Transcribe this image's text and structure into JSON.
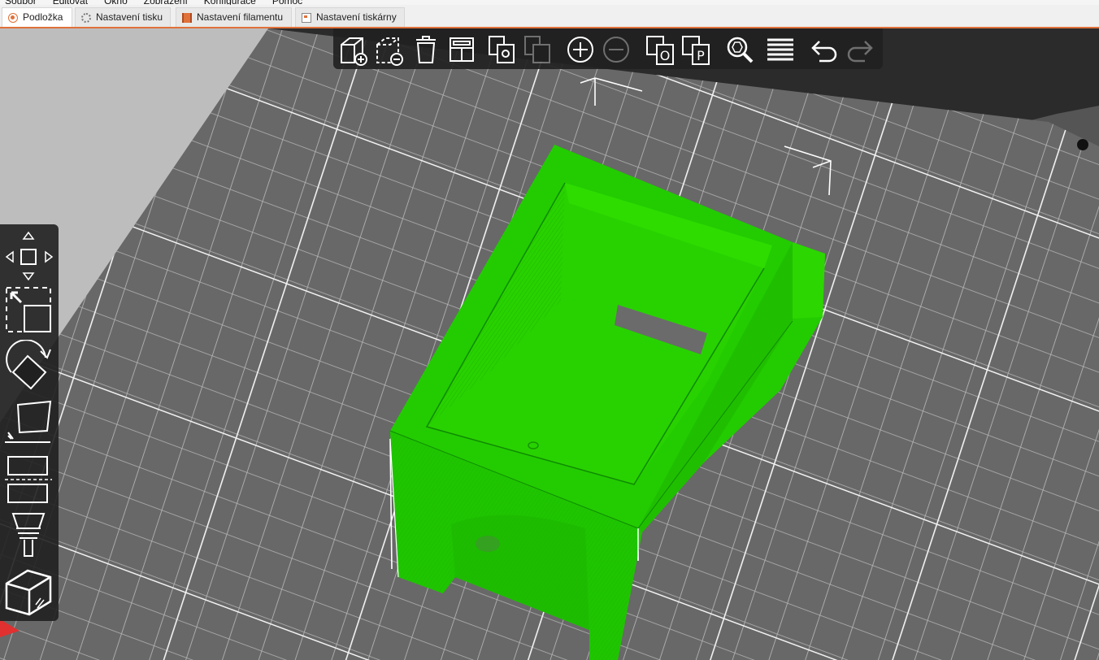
{
  "menu": [
    "Soubor",
    "Editovat",
    "Okno",
    "Zobrazení",
    "Konfigurace",
    "Pomoc"
  ],
  "tabs": [
    {
      "label": "Podložka",
      "icon": "plater-icon",
      "active": true
    },
    {
      "label": "Nastavení tisku",
      "icon": "gear-icon",
      "active": false
    },
    {
      "label": "Nastavení filamentu",
      "icon": "filament-spool-icon",
      "active": false
    },
    {
      "label": "Nastavení tiskárny",
      "icon": "printer-icon",
      "active": false
    }
  ],
  "toolbar_icons": [
    "add-object-icon",
    "delete-object-icon",
    "delete-all-icon",
    "arrange-icon",
    "copy-icon",
    "paste-icon",
    "add-instance-icon",
    "remove-instance-icon",
    "split-to-objects-icon",
    "split-to-parts-icon",
    "search-icon",
    "layers-editing-icon",
    "undo-icon",
    "redo-icon"
  ],
  "gizmo_icons": [
    "move-icon",
    "scale-icon",
    "rotate-icon",
    "place-on-face-icon",
    "cut-icon",
    "paint-support-icon",
    "view-cube-icon"
  ],
  "colors": {
    "model": "#22cc00",
    "accent": "#e0713a",
    "bed": "#6a6a6a",
    "grid_line": "#c8c8c8",
    "toolbar_bg": "#202020"
  }
}
